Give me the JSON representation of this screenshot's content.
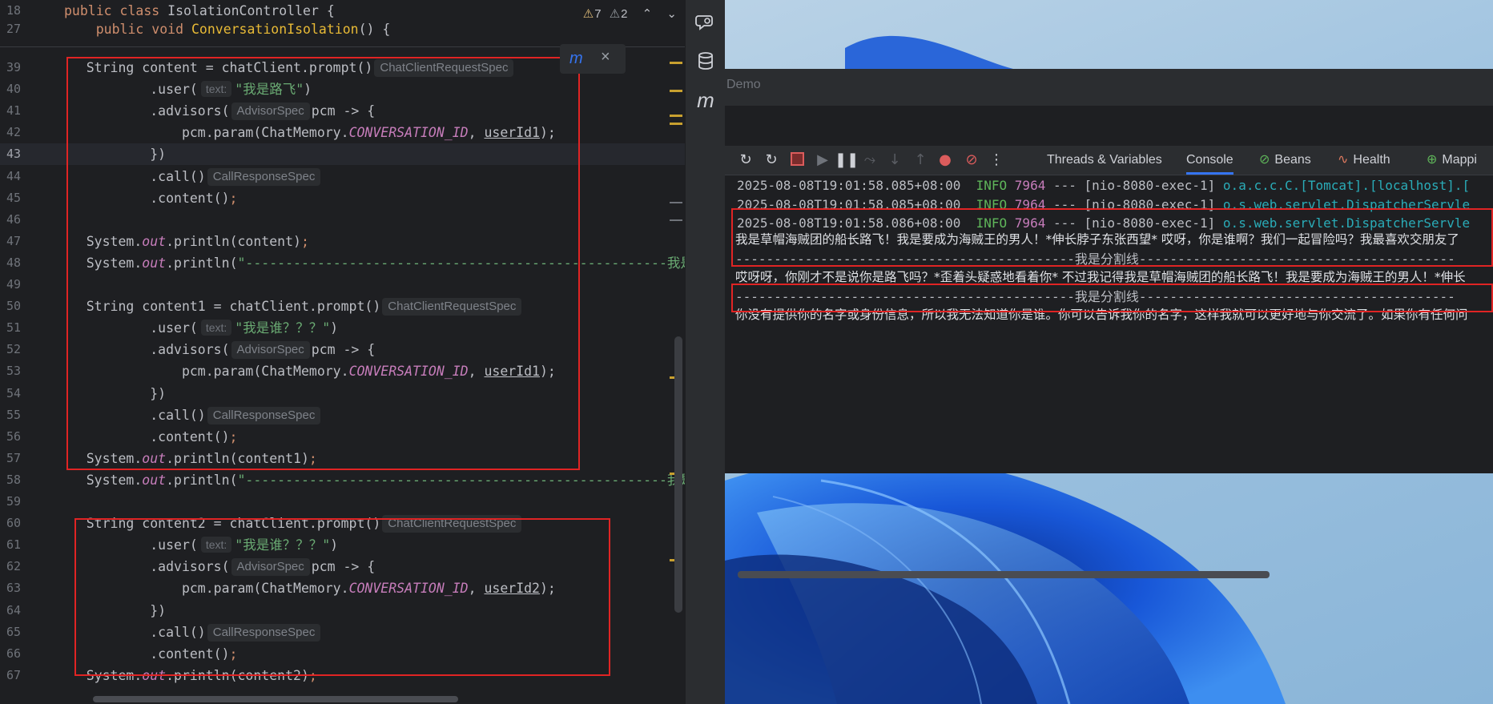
{
  "editor": {
    "sticky": [
      {
        "num": "18",
        "segments": [
          {
            "t": "public class ",
            "c": "kw"
          },
          {
            "t": "IsolationController {",
            "c": ""
          }
        ]
      },
      {
        "num": "27",
        "segments": [
          {
            "t": "    public void ",
            "c": "kw"
          },
          {
            "t": "ConversationIsolation",
            "c": "meth"
          },
          {
            "t": "() {",
            "c": ""
          }
        ]
      }
    ],
    "warnings": {
      "warn_count": "7",
      "weak_count": "2",
      "up": "⌃",
      "down": "⌄"
    },
    "popup_close": "×",
    "lines": [
      {
        "num": "39",
        "segments": [
          {
            "t": "    String content = chatClient.prompt()",
            "c": ""
          },
          {
            "t": "ChatClientRequestSpec",
            "c": "hint"
          }
        ]
      },
      {
        "num": "40",
        "segments": [
          {
            "t": "            .user(",
            "c": ""
          },
          {
            "t": "text:",
            "c": "hintlbl"
          },
          {
            "t": "\"我是路飞\"",
            "c": "str"
          },
          {
            "t": ")",
            "c": ""
          }
        ]
      },
      {
        "num": "41",
        "segments": [
          {
            "t": "            .advisors(",
            "c": ""
          },
          {
            "t": "AdvisorSpec",
            "c": "hint"
          },
          {
            "t": "pcm -> {",
            "c": ""
          }
        ]
      },
      {
        "num": "42",
        "segments": [
          {
            "t": "                pcm.param(ChatMemory.",
            "c": ""
          },
          {
            "t": "CONVERSATION_ID",
            "c": "field"
          },
          {
            "t": ", ",
            "c": ""
          },
          {
            "t": "userId1",
            "c": "under"
          },
          {
            "t": ");",
            "c": ""
          }
        ]
      },
      {
        "num": "43",
        "current": true,
        "segments": [
          {
            "t": "            })",
            "c": ""
          }
        ]
      },
      {
        "num": "44",
        "segments": [
          {
            "t": "            .call()",
            "c": ""
          },
          {
            "t": "CallResponseSpec",
            "c": "hint"
          }
        ]
      },
      {
        "num": "45",
        "segments": [
          {
            "t": "            .content()",
            "c": ""
          },
          {
            "t": ";",
            "c": "sem"
          }
        ]
      },
      {
        "num": "46",
        "segments": []
      },
      {
        "num": "47",
        "segments": [
          {
            "t": "    System.",
            "c": ""
          },
          {
            "t": "out",
            "c": "field"
          },
          {
            "t": ".println(content)",
            "c": ""
          },
          {
            "t": ";",
            "c": "sem"
          }
        ]
      },
      {
        "num": "48",
        "segments": [
          {
            "t": "    System.",
            "c": ""
          },
          {
            "t": "out",
            "c": "field"
          },
          {
            "t": ".println(",
            "c": ""
          },
          {
            "t": "\"-----------------------------------------------------我是分割线-----",
            "c": "str"
          }
        ]
      },
      {
        "num": "49",
        "segments": []
      },
      {
        "num": "50",
        "segments": [
          {
            "t": "    String content1 = chatClient.prompt()",
            "c": ""
          },
          {
            "t": "ChatClientRequestSpec",
            "c": "hint"
          }
        ]
      },
      {
        "num": "51",
        "segments": [
          {
            "t": "            .user(",
            "c": ""
          },
          {
            "t": "text:",
            "c": "hintlbl"
          },
          {
            "t": "\"我是谁？？？\"",
            "c": "str"
          },
          {
            "t": ")",
            "c": ""
          }
        ]
      },
      {
        "num": "52",
        "segments": [
          {
            "t": "            .advisors(",
            "c": ""
          },
          {
            "t": "AdvisorSpec",
            "c": "hint"
          },
          {
            "t": "pcm -> {",
            "c": ""
          }
        ]
      },
      {
        "num": "53",
        "segments": [
          {
            "t": "                pcm.param(ChatMemory.",
            "c": ""
          },
          {
            "t": "CONVERSATION_ID",
            "c": "field"
          },
          {
            "t": ", ",
            "c": ""
          },
          {
            "t": "userId1",
            "c": "under"
          },
          {
            "t": ");",
            "c": ""
          }
        ]
      },
      {
        "num": "54",
        "segments": [
          {
            "t": "            })",
            "c": ""
          }
        ]
      },
      {
        "num": "55",
        "segments": [
          {
            "t": "            .call()",
            "c": ""
          },
          {
            "t": "CallResponseSpec",
            "c": "hint"
          }
        ]
      },
      {
        "num": "56",
        "segments": [
          {
            "t": "            .content()",
            "c": ""
          },
          {
            "t": ";",
            "c": "sem"
          }
        ]
      },
      {
        "num": "57",
        "segments": [
          {
            "t": "    System.",
            "c": ""
          },
          {
            "t": "out",
            "c": "field"
          },
          {
            "t": ".println(content1)",
            "c": ""
          },
          {
            "t": ";",
            "c": "sem"
          }
        ]
      },
      {
        "num": "58",
        "segments": [
          {
            "t": "    System.",
            "c": ""
          },
          {
            "t": "out",
            "c": "field"
          },
          {
            "t": ".println(",
            "c": ""
          },
          {
            "t": "\"-----------------------------------------------------我是分割线-----",
            "c": "str"
          }
        ]
      },
      {
        "num": "59",
        "segments": []
      },
      {
        "num": "60",
        "segments": [
          {
            "t": "    String content2 = chatClient.prompt()",
            "c": ""
          },
          {
            "t": "ChatClientRequestSpec",
            "c": "hint"
          }
        ]
      },
      {
        "num": "61",
        "segments": [
          {
            "t": "            .user(",
            "c": ""
          },
          {
            "t": "text:",
            "c": "hintlbl"
          },
          {
            "t": "\"我是谁？？？\"",
            "c": "str"
          },
          {
            "t": ")",
            "c": ""
          }
        ]
      },
      {
        "num": "62",
        "segments": [
          {
            "t": "            .advisors(",
            "c": ""
          },
          {
            "t": "AdvisorSpec",
            "c": "hint"
          },
          {
            "t": "pcm -> {",
            "c": ""
          }
        ]
      },
      {
        "num": "63",
        "segments": [
          {
            "t": "                pcm.param(ChatMemory.",
            "c": ""
          },
          {
            "t": "CONVERSATION_ID",
            "c": "field"
          },
          {
            "t": ", ",
            "c": ""
          },
          {
            "t": "userId2",
            "c": "under"
          },
          {
            "t": ");",
            "c": ""
          }
        ]
      },
      {
        "num": "64",
        "segments": [
          {
            "t": "            })",
            "c": ""
          }
        ]
      },
      {
        "num": "65",
        "segments": [
          {
            "t": "            .call()",
            "c": ""
          },
          {
            "t": "CallResponseSpec",
            "c": "hint"
          }
        ]
      },
      {
        "num": "66",
        "segments": [
          {
            "t": "            .content()",
            "c": ""
          },
          {
            "t": ";",
            "c": "sem"
          }
        ]
      },
      {
        "num": "67",
        "segments": [
          {
            "t": "    System.",
            "c": ""
          },
          {
            "t": "out",
            "c": "field"
          },
          {
            "t": ".println(content2)",
            "c": ""
          },
          {
            "t": ";",
            "c": "sem"
          }
        ]
      }
    ]
  },
  "side_strip": {
    "icons": [
      "ai-assistant-icon",
      "database-icon",
      "maven-icon"
    ],
    "maven_glyph": "m"
  },
  "run_window": {
    "title": "Demo",
    "tabs": [
      {
        "label": "Threads & Variables",
        "active": false
      },
      {
        "label": "Console",
        "active": true
      },
      {
        "label": "Beans",
        "active": false
      },
      {
        "label": "Health",
        "active": false
      },
      {
        "label": "Mappi",
        "active": false
      }
    ],
    "log_lines": [
      {
        "ts": "2025-08-08T19:01:58.085+08:00",
        "level": "INFO",
        "pid": "7964",
        "sep": "---",
        "thread": "[nio-8080-exec-1]",
        "logger": "o.a.c.c.C.[Tomcat].[localhost].["
      },
      {
        "ts": "2025-08-08T19:01:58.085+08:00",
        "level": "INFO",
        "pid": "7964",
        "sep": "---",
        "thread": "[nio-8080-exec-1]",
        "logger": "o.s.web.servlet.DispatcherServle"
      },
      {
        "ts": "2025-08-08T19:01:58.086+08:00",
        "level": "INFO",
        "pid": "7964",
        "sep": "---",
        "thread": "[nio-8080-exec-1]",
        "logger": "o.s.web.servlet.DispatcherServle"
      }
    ],
    "output_lines": [
      "我是草帽海贼团的船长路飞！我是要成为海贼王的男人！*伸长脖子东张西望* 哎呀，你是谁啊？我们一起冒险吗？我最喜欢交朋友了",
      "--------------------------------------------我是分割线-----------------------------------------",
      "哎呀呀，你刚才不是说你是路飞吗？*歪着头疑惑地看着你* 不过我记得我是草帽海贼团的船长路飞！我是要成为海贼王的男人！*伸长",
      "--------------------------------------------我是分割线-----------------------------------------",
      "你没有提供你的名字或身份信息，所以我无法知道你是谁。你可以告诉我你的名字，这样我就可以更好地与你交流了。如果你有任何问"
    ]
  },
  "colors": {
    "highlight_box": "#e02424",
    "accent": "#3574f0"
  }
}
